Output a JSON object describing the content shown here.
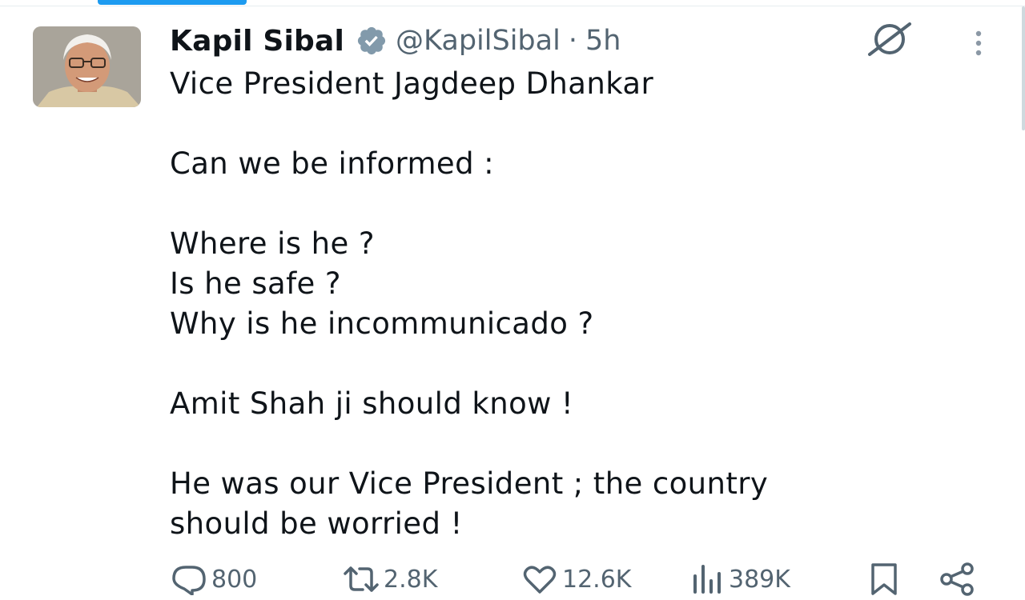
{
  "colors": {
    "accent": "#1d9bf0",
    "text": "#0f1419",
    "muted": "#536471"
  },
  "tweet": {
    "author": {
      "name": "Kapil Sibal",
      "verified_icon": "verified-badge-icon",
      "handle": "@KapilSibal",
      "separator": "·",
      "time": "5h"
    },
    "lines": [
      "Vice President Jagdeep Dhankar",
      "Can we be informed :",
      "Where is he ?",
      "Is he safe ?",
      "Why is he incommunicado ?",
      "Amit Shah ji should know !",
      "He was our Vice President ; the country",
      "should be worried !"
    ],
    "header_icons": [
      "grok-icon",
      "more-options-icon"
    ]
  },
  "actions": {
    "replies": "800",
    "reposts": "2.8K",
    "likes": "12.6K",
    "views": "389K",
    "icons": [
      "reply-icon",
      "repost-icon",
      "like-icon",
      "views-icon",
      "bookmark-icon",
      "share-icon"
    ]
  }
}
